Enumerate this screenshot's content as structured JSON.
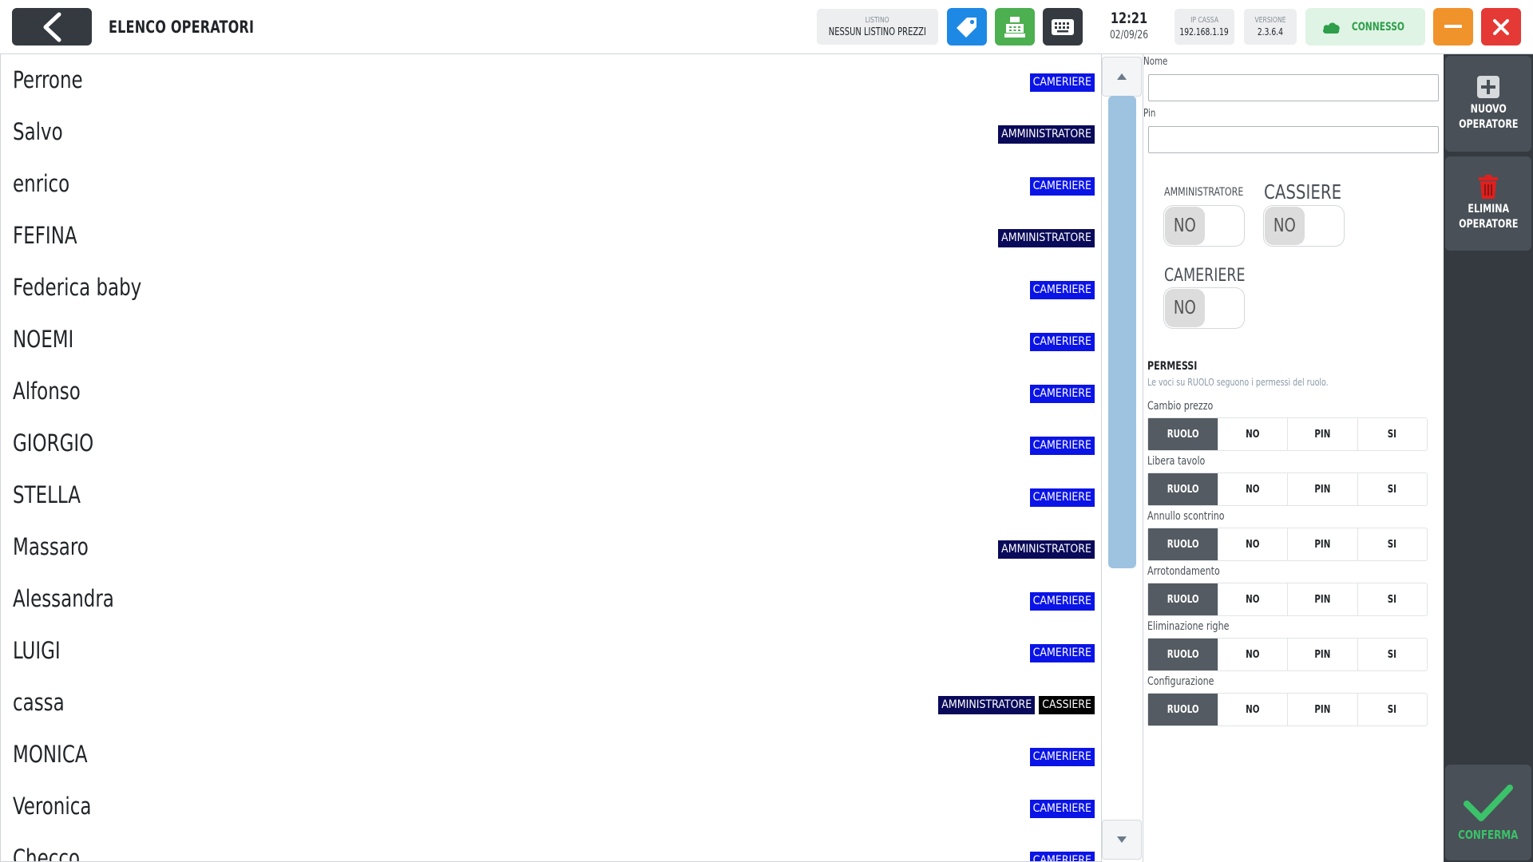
{
  "header": {
    "title": "ELENCO OPERATORI",
    "listino_label": "LISTINO",
    "listino_value": "NESSUN LISTINO PREZZI",
    "time": "12:21",
    "date": "02/09/26",
    "ip_label": "IP CASSA",
    "ip_value": "192.168.1.19",
    "version_label": "VERSIONE",
    "version_value": "2.3.6.4",
    "connection": "CONNESSO",
    "colors": {
      "tag_button": "#1e88e5",
      "register_button": "#4caf50",
      "keyboard_button": "#343a40",
      "minimize_button": "#f0932b",
      "close_button": "#e53935",
      "connected": "#2e9e4b"
    }
  },
  "operators": [
    {
      "name": "Perrone",
      "roles": [
        "CAMERIERE"
      ]
    },
    {
      "name": "Salvo",
      "roles": [
        "AMMINISTRATORE"
      ]
    },
    {
      "name": "enrico",
      "roles": [
        "CAMERIERE"
      ]
    },
    {
      "name": "FEFINA",
      "roles": [
        "AMMINISTRATORE"
      ]
    },
    {
      "name": "Federica baby",
      "roles": [
        "CAMERIERE"
      ]
    },
    {
      "name": "NOEMI",
      "roles": [
        "CAMERIERE"
      ]
    },
    {
      "name": "Alfonso",
      "roles": [
        "CAMERIERE"
      ]
    },
    {
      "name": "GIORGIO",
      "roles": [
        "CAMERIERE"
      ]
    },
    {
      "name": "STELLA",
      "roles": [
        "CAMERIERE"
      ]
    },
    {
      "name": "Massaro",
      "roles": [
        "AMMINISTRATORE"
      ]
    },
    {
      "name": "Alessandra",
      "roles": [
        "CAMERIERE"
      ]
    },
    {
      "name": "LUIGI",
      "roles": [
        "CAMERIERE"
      ]
    },
    {
      "name": "cassa",
      "roles": [
        "AMMINISTRATORE",
        "CASSIERE"
      ]
    },
    {
      "name": "MONICA",
      "roles": [
        "CAMERIERE"
      ]
    },
    {
      "name": "Veronica",
      "roles": [
        "CAMERIERE"
      ]
    },
    {
      "name": "Checco",
      "roles": [
        "CAMERIERE"
      ]
    }
  ],
  "form": {
    "name_label": "Nome",
    "name_value": "",
    "pin_label": "Pin",
    "pin_value": "",
    "admin_label": "AMMINISTRATORE",
    "admin_value": "NO",
    "cashier_label": "CASSIERE",
    "cashier_value": "NO",
    "waiter_label": "CAMERIERE",
    "waiter_value": "NO"
  },
  "permissions": {
    "title": "PERMESSI",
    "note": "Le voci su RUOLO seguono i permessi del ruolo.",
    "options": [
      "RUOLO",
      "NO",
      "PIN",
      "SI"
    ],
    "items": [
      {
        "label": "Cambio prezzo",
        "selected": "RUOLO"
      },
      {
        "label": "Libera tavolo",
        "selected": "RUOLO"
      },
      {
        "label": "Annullo scontrino",
        "selected": "RUOLO"
      },
      {
        "label": "Arrotondamento",
        "selected": "RUOLO"
      },
      {
        "label": "Eliminazione righe",
        "selected": "RUOLO"
      },
      {
        "label": "Configurazione",
        "selected": "RUOLO"
      }
    ]
  },
  "actions": {
    "new_line1": "NUOVO",
    "new_line2": "OPERATORE",
    "delete_line1": "ELIMINA",
    "delete_line2": "OPERATORE",
    "confirm": "CONFERMA"
  },
  "role_colors": {
    "CAMERIERE": "#0b14e6",
    "AMMINISTRATORE": "#0a0a5a",
    "CASSIERE": "#000000"
  }
}
